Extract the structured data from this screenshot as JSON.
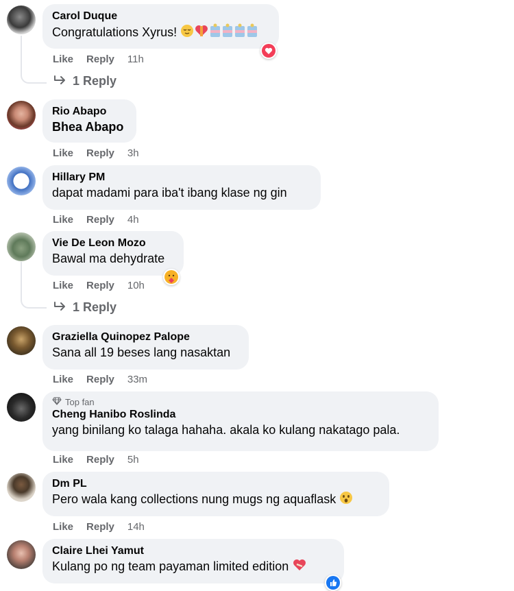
{
  "comments": [
    {
      "author": "Carol Duque",
      "text": "Congratulations Xyrus!",
      "like": "Like",
      "reply": "Reply",
      "time": "11h",
      "replies": "1 Reply"
    },
    {
      "author": "Rio Abapo",
      "text": "Bhea Abapo",
      "like": "Like",
      "reply": "Reply",
      "time": "3h"
    },
    {
      "author": "Hillary PM",
      "text": "dapat madami para iba't ibang klase ng gin",
      "like": "Like",
      "reply": "Reply",
      "time": "4h"
    },
    {
      "author": "Vie De Leon Mozo",
      "text": "Bawal ma dehydrate",
      "like": "Like",
      "reply": "Reply",
      "time": "10h",
      "replies": "1 Reply"
    },
    {
      "author": "Graziella Quinopez Palope",
      "text": "Sana all 19 beses lang nasaktan",
      "like": "Like",
      "reply": "Reply",
      "time": "33m"
    },
    {
      "author": "Cheng Hanibo Roslinda",
      "badge": "Top fan",
      "text": "yang binilang ko talaga hahaha. akala ko kulang nakatago pala.",
      "like": "Like",
      "reply": "Reply",
      "time": "5h"
    },
    {
      "author": "Dm PL",
      "text": "Pero wala kang collections nung mugs ng aquaflask",
      "like": "Like",
      "reply": "Reply",
      "time": "14h"
    },
    {
      "author": "Claire Lhei Yamut",
      "text": "Kulang po ng team payaman limited edition"
    }
  ],
  "colors": {
    "bubble": "#f0f2f5",
    "meta": "#65676b",
    "love": "#f33e58",
    "like": "#1877f2"
  }
}
